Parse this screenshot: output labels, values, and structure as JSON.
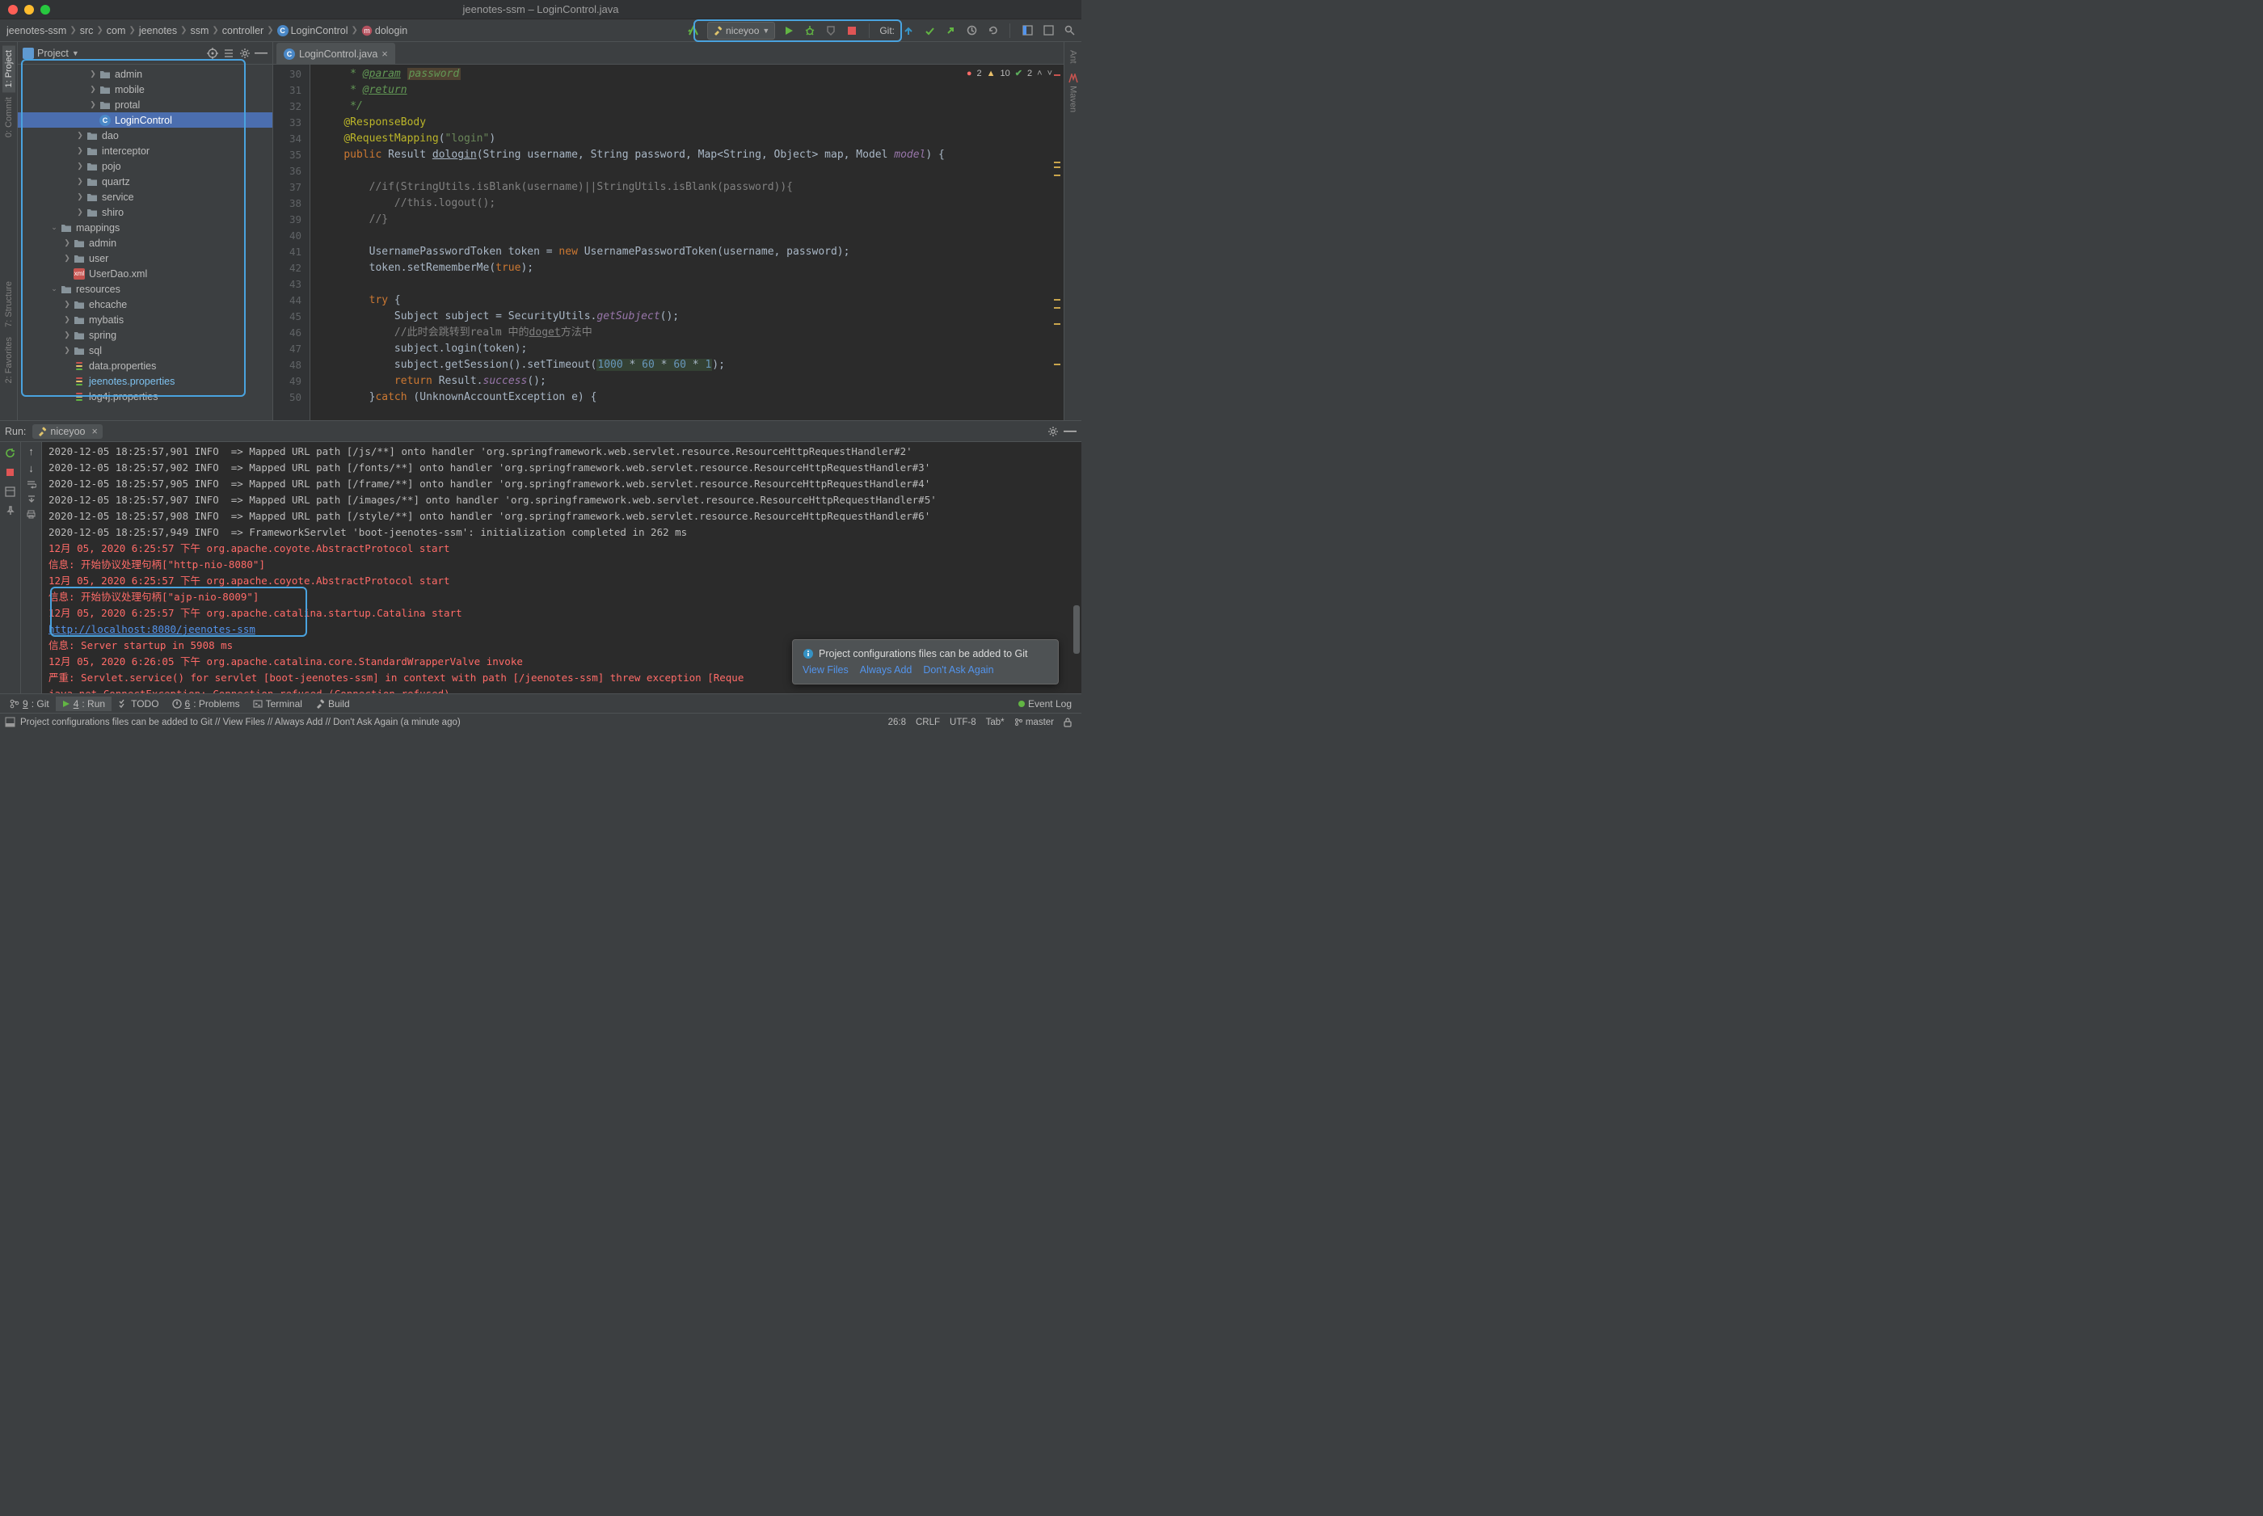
{
  "title": "jeenotes-ssm – LoginControl.java",
  "breadcrumbs": [
    "jeenotes-ssm",
    "src",
    "com",
    "jeenotes",
    "ssm",
    "controller",
    "LoginControl",
    "dologin"
  ],
  "run_config_name": "niceyoo",
  "git_label": "Git:",
  "project_panel": {
    "title": "Project",
    "tree": [
      {
        "indent": 5,
        "arrow": ">",
        "icon": "folder",
        "label": "admin"
      },
      {
        "indent": 5,
        "arrow": ">",
        "icon": "folder",
        "label": "mobile"
      },
      {
        "indent": 5,
        "arrow": ">",
        "icon": "folder",
        "label": "protal"
      },
      {
        "indent": 5,
        "arrow": "",
        "icon": "class",
        "label": "LoginControl",
        "sel": true
      },
      {
        "indent": 4,
        "arrow": ">",
        "icon": "folder",
        "label": "dao"
      },
      {
        "indent": 4,
        "arrow": ">",
        "icon": "folder",
        "label": "interceptor"
      },
      {
        "indent": 4,
        "arrow": ">",
        "icon": "folder",
        "label": "pojo"
      },
      {
        "indent": 4,
        "arrow": ">",
        "icon": "folder",
        "label": "quartz"
      },
      {
        "indent": 4,
        "arrow": ">",
        "icon": "folder",
        "label": "service"
      },
      {
        "indent": 4,
        "arrow": ">",
        "icon": "folder",
        "label": "shiro"
      },
      {
        "indent": 2,
        "arrow": "v",
        "icon": "folder",
        "label": "mappings"
      },
      {
        "indent": 3,
        "arrow": ">",
        "icon": "folder",
        "label": "admin"
      },
      {
        "indent": 3,
        "arrow": ">",
        "icon": "folder",
        "label": "user"
      },
      {
        "indent": 3,
        "arrow": "",
        "icon": "xml",
        "label": "UserDao.xml"
      },
      {
        "indent": 2,
        "arrow": "v",
        "icon": "folder",
        "label": "resources"
      },
      {
        "indent": 3,
        "arrow": ">",
        "icon": "folder",
        "label": "ehcache"
      },
      {
        "indent": 3,
        "arrow": ">",
        "icon": "folder",
        "label": "mybatis"
      },
      {
        "indent": 3,
        "arrow": ">",
        "icon": "folder",
        "label": "spring"
      },
      {
        "indent": 3,
        "arrow": ">",
        "icon": "folder",
        "label": "sql"
      },
      {
        "indent": 3,
        "arrow": "",
        "icon": "props",
        "label": "data.properties"
      },
      {
        "indent": 3,
        "arrow": "",
        "icon": "props",
        "label": "jeenotes.properties",
        "hl": true
      },
      {
        "indent": 3,
        "arrow": "",
        "icon": "props",
        "label": "log4j.properties"
      }
    ]
  },
  "editor_tab": "LoginControl.java",
  "gutter_start": 30,
  "gutter_end": 50,
  "code_lines": [
    {
      "html": "     <span class='doc'>* </span><span class='doc-tag'>@param</span> <span class='param-box doc'>password</span>"
    },
    {
      "html": "     <span class='doc'>* </span><span class='doc-tag'>@return</span>"
    },
    {
      "html": "     <span class='doc'>*/</span>"
    },
    {
      "html": "    <span class='ann'>@ResponseBody</span>"
    },
    {
      "html": "    <span class='ann'>@RequestMapping</span>(<span class='str'>\"login\"</span>)"
    },
    {
      "html": "    <span class='kw'>public</span> Result <span class='underln'>dologin</span>(String username, String password, Map&lt;String, Object&gt; map, Model <span class='ital'>model</span>) {"
    },
    {
      "html": ""
    },
    {
      "html": "        <span class='cmt'>//if(StringUtils.isBlank(username)||StringUtils.isBlank(password)){</span>"
    },
    {
      "html": "            <span class='cmt'>//this.logout();</span>"
    },
    {
      "html": "        <span class='cmt'>//}</span>"
    },
    {
      "html": ""
    },
    {
      "html": "        UsernamePasswordToken token = <span class='kw'>new</span> UsernamePasswordToken(username, password);"
    },
    {
      "html": "        token.setRememberMe(<span class='kw'>true</span>);"
    },
    {
      "html": ""
    },
    {
      "html": "        <span class='kw'>try</span> {"
    },
    {
      "html": "            Subject subject = SecurityUtils.<span class='ital'>getSubject</span>();"
    },
    {
      "html": "            <span class='cmt'>//此时会跳转到realm 中的<span class='underln'>doget</span>方法中</span>"
    },
    {
      "html": "            subject.login(token);"
    },
    {
      "html": "            subject.getSession().setTimeout(<span class='num-box'><span class='num'>1000</span> * <span class='num'>60</span> * <span class='num'>60</span> * <span class='num'>1</span></span>);"
    },
    {
      "html": "            <span class='kw'>return</span> Result.<span class='ital'>success</span>();"
    },
    {
      "html": "        }<span class='kw'>catch</span> (UnknownAccountException e) {"
    }
  ],
  "inspections": {
    "errors": "2",
    "warnings": "10",
    "ok": "2"
  },
  "run_panel": {
    "label": "Run:",
    "tab": "niceyoo"
  },
  "console_lines": [
    {
      "cls": "",
      "text": "2020-12-05 18:25:57,901 INFO  => Mapped URL path [/js/**] onto handler 'org.springframework.web.servlet.resource.ResourceHttpRequestHandler#2'"
    },
    {
      "cls": "",
      "text": "2020-12-05 18:25:57,902 INFO  => Mapped URL path [/fonts/**] onto handler 'org.springframework.web.servlet.resource.ResourceHttpRequestHandler#3'"
    },
    {
      "cls": "",
      "text": "2020-12-05 18:25:57,905 INFO  => Mapped URL path [/frame/**] onto handler 'org.springframework.web.servlet.resource.ResourceHttpRequestHandler#4'"
    },
    {
      "cls": "",
      "text": "2020-12-05 18:25:57,907 INFO  => Mapped URL path [/images/**] onto handler 'org.springframework.web.servlet.resource.ResourceHttpRequestHandler#5'"
    },
    {
      "cls": "",
      "text": "2020-12-05 18:25:57,908 INFO  => Mapped URL path [/style/**] onto handler 'org.springframework.web.servlet.resource.ResourceHttpRequestHandler#6'"
    },
    {
      "cls": "",
      "text": "2020-12-05 18:25:57,949 INFO  => FrameworkServlet 'boot-jeenotes-ssm': initialization completed in 262 ms"
    },
    {
      "cls": "red",
      "text": "12月 05, 2020 6:25:57 下午 org.apache.coyote.AbstractProtocol start"
    },
    {
      "cls": "red",
      "text": "信息: 开始协议处理句柄[\"http-nio-8080\"]"
    },
    {
      "cls": "red",
      "text": "12月 05, 2020 6:25:57 下午 org.apache.coyote.AbstractProtocol start"
    },
    {
      "cls": "red",
      "text": "信息: 开始协议处理句柄[\"ajp-nio-8009\"]"
    },
    {
      "cls": "red",
      "text": "12月 05, 2020 6:25:57 下午 org.apache.catalina.startup.Catalina start"
    },
    {
      "cls": "link",
      "text": "http://localhost:8080/jeenotes-ssm"
    },
    {
      "cls": "red",
      "text": "信息: Server startup in 5908 ms"
    },
    {
      "cls": "red",
      "text": "12月 05, 2020 6:26:05 下午 org.apache.catalina.core.StandardWrapperValve invoke"
    },
    {
      "cls": "red",
      "text": "严重: Servlet.service() for servlet [boot-jeenotes-ssm] in context with path [/jeenotes-ssm] threw exception [Reque"
    },
    {
      "cls": "red",
      "text": "java.net.ConnectException: Connection refused (Connection refused)"
    }
  ],
  "tool_buttons": {
    "git": " 9: Git",
    "run": " 4: Run",
    "todo": " TODO",
    "problems": " 6: Problems",
    "terminal": " Terminal",
    "build": " Build",
    "event_log": " Event Log"
  },
  "notification": {
    "title": "Project configurations files can be added to Git",
    "actions": [
      "View Files",
      "Always Add",
      "Don't Ask Again"
    ]
  },
  "status_bar": {
    "msg": "Project configurations files can be added to Git // View Files // Always Add // Don't Ask Again (a minute ago)",
    "pos": "26:8",
    "sep": "CRLF",
    "enc": "UTF-8",
    "tab": "Tab*",
    "branch": "master"
  },
  "left_tabs": [
    "1: Project",
    "0: Commit"
  ],
  "left_tabs_bottom": [
    "7: Structure",
    "2: Favorites"
  ],
  "right_tabs": [
    "Ant",
    "Maven"
  ]
}
